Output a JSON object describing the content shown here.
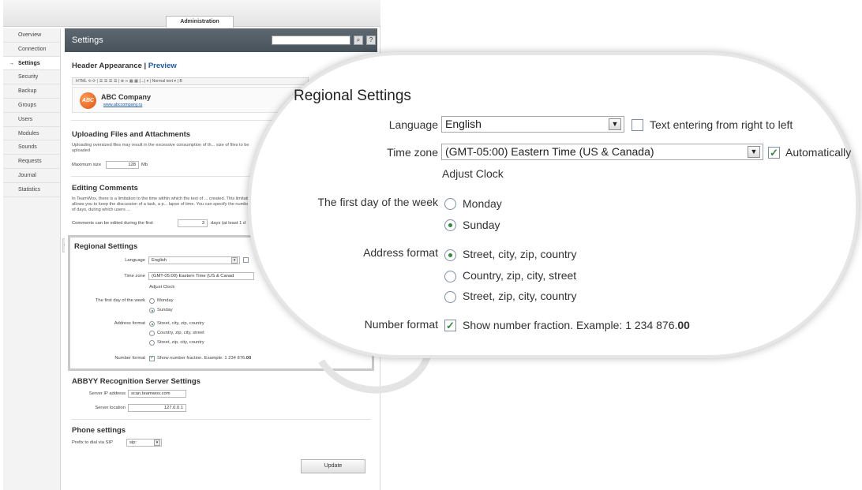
{
  "top_tab": "Administration",
  "sidebar": {
    "items": [
      "Overview",
      "Connection",
      "Settings",
      "Security",
      "Backup",
      "Groups",
      "Users",
      "Modules",
      "Sounds",
      "Requests",
      "Journal",
      "Statistics"
    ],
    "active": "Settings"
  },
  "header": {
    "title": "Settings",
    "search_icon": "magnifier-icon",
    "help_label": "?"
  },
  "header_appearance": {
    "title": "Header Appearance |",
    "preview_link": "Preview",
    "toolbar_text": "HTML  ⟲ ⟳ | ☰ ☰ ☰ ☰ | ⊕ ∞ ▦ ▦ (...) ▾ | Normal text ▾ | B",
    "company_name": "ABC Company",
    "company_url": "www.abccompany.ru",
    "logo_text": "ABC"
  },
  "uploading": {
    "title": "Uploading Files and Attachments",
    "desc": "Uploading oversized files may result in the excessive consumption of th... size of files to be uploaded",
    "max_label": "Maximum size",
    "max_value": "128",
    "max_unit": "Mb"
  },
  "editing": {
    "title": "Editing Comments",
    "desc": "In TeamWox, there is a limitation to the time within which the text of ... created. This limitation allows you to keep the discussion of a task, a p... lapse of time. You can specify the number of days, during which users ...",
    "edit_label": "Comments can be edited during the first",
    "edit_value": "3",
    "edit_suffix": "days (at least 1 d"
  },
  "regional_small": {
    "title": "Regional Settings",
    "language_label": "Language",
    "language_value": "English",
    "timezone_label": "Time zone",
    "timezone_value": "(GMT-05:00) Eastern Time (US & Canad",
    "adjust_clock": "Adjust Clock",
    "first_day_label": "The first day of the week",
    "days": [
      "Monday",
      "Sunday"
    ],
    "address_label": "Address format",
    "address_options": [
      "Street, city, zip, country",
      "Country, zip, city, street",
      "Street, zip, city, country"
    ],
    "number_label": "Number format",
    "number_text": "Show number fraction. Example: 1 234 876.",
    "number_bold": "00"
  },
  "abbyy": {
    "title": "ABBYY Recognition Server Settings",
    "ip_label": "Server IP address",
    "ip_value": "scan.teamwox.com",
    "location_label": "Server location",
    "location_value": "127.0.0.1"
  },
  "phone": {
    "title": "Phone settings",
    "prefix_label": "Prefix to dial via SIP",
    "prefix_value": "sip:"
  },
  "update_button": "Update",
  "callout": {
    "title": "Regional Settings",
    "language_label": "Language",
    "language_value": "English",
    "rtl_label": "Text entering from right to left",
    "rtl_checked": false,
    "timezone_label": "Time zone",
    "timezone_value": "(GMT-05:00) Eastern Time (US & Canada)",
    "auto_label": "Automatically",
    "auto_checked": true,
    "adjust_clock": "Adjust Clock",
    "first_day_label": "The first day of the week",
    "days": [
      "Monday",
      "Sunday"
    ],
    "selected_day": "Sunday",
    "address_label": "Address format",
    "address_options": [
      "Street, city, zip, country",
      "Country, zip, city, street",
      "Street, zip, city, country"
    ],
    "selected_address": "Street, city, zip, country",
    "number_label": "Number format",
    "number_text": "Show number fraction. Example: 1 234 876.",
    "number_bold": "00",
    "number_checked": true
  },
  "colors": {
    "accent_green": "#2f8a3c",
    "header_dark": "#48525a",
    "link_blue": "#1b5aa6"
  }
}
